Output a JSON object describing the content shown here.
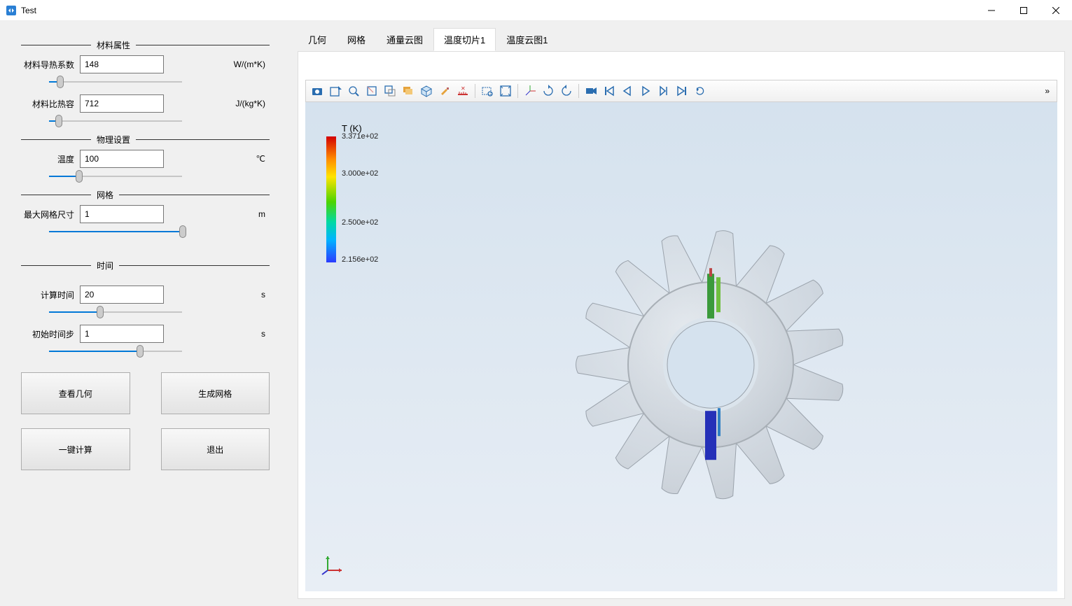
{
  "window": {
    "title": "Test"
  },
  "tabs": {
    "items": [
      "几何",
      "网格",
      "通量云图",
      "温度切片1",
      "温度云图1"
    ],
    "active_index": 3
  },
  "sidebar": {
    "sections": {
      "material": {
        "title": "材料属性",
        "thermal_conductivity": {
          "label": "材料导热系数",
          "value": "148",
          "unit": "W/(m*K)",
          "slider_pct": 8
        },
        "specific_heat": {
          "label": "材料比热容",
          "value": "712",
          "unit": "J/(kg*K)",
          "slider_pct": 7
        }
      },
      "physics": {
        "title": "物理设置",
        "temperature": {
          "label": "温度",
          "value": "100",
          "unit": "℃",
          "slider_pct": 22
        }
      },
      "mesh": {
        "title": "网格",
        "max_size": {
          "label": "最大网格尺寸",
          "value": "1",
          "unit": "m",
          "slider_pct": 100
        }
      },
      "time": {
        "title": "时间",
        "compute_time": {
          "label": "计算时间",
          "value": "20",
          "unit": "s",
          "slider_pct": 38
        },
        "init_step": {
          "label": "初始时间步",
          "value": "1",
          "unit": "s",
          "slider_pct": 68
        }
      }
    },
    "buttons": {
      "view_geometry": "查看几何",
      "generate_mesh": "生成网格",
      "compute": "一键计算",
      "exit": "退出"
    }
  },
  "toolbar": {
    "icons": [
      "camera",
      "export",
      "zoom",
      "selection-box",
      "box-sub",
      "layers",
      "cube-light",
      "marker-orange",
      "ruler-red",
      "zoom-rect",
      "fit-all",
      "rotate-axes",
      "cw",
      "ccw",
      "video-camera",
      "first",
      "prev",
      "play",
      "step",
      "last",
      "loop"
    ]
  },
  "legend": {
    "title": "T (K)",
    "ticks": [
      {
        "label": "3.371e+02",
        "pos": 0
      },
      {
        "label": "3.000e+02",
        "pos": 30
      },
      {
        "label": "2.500e+02",
        "pos": 70
      },
      {
        "label": "2.156e+02",
        "pos": 100
      }
    ]
  }
}
